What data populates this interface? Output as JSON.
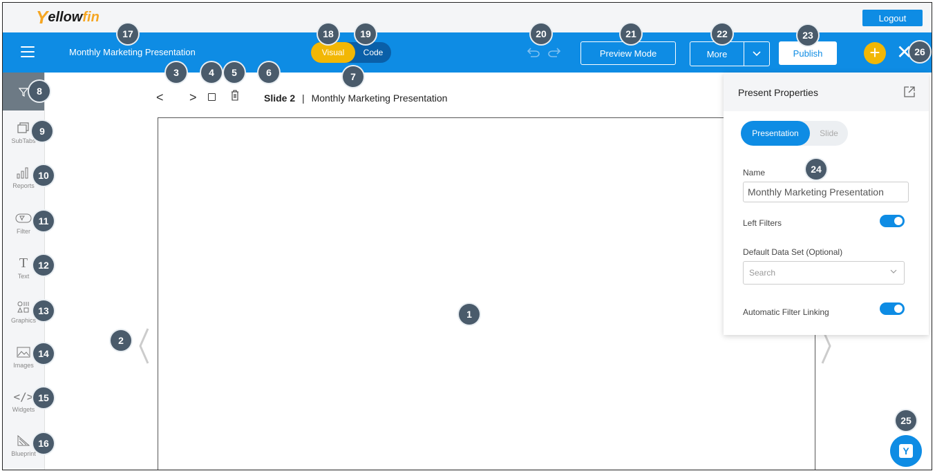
{
  "brand": {
    "logo_prefix": "ellow",
    "logo_suffix": "fin"
  },
  "header": {
    "logout_label": "Logout",
    "doc_title": "Monthly Marketing Presentation",
    "mode_visual": "Visual",
    "mode_code": "Code",
    "preview_label": "Preview Mode",
    "more_label": "More",
    "publish_label": "Publish"
  },
  "sidebar": {
    "items": [
      {
        "label": "SubTabs",
        "icon": "subtabs-icon"
      },
      {
        "label": "Reports",
        "icon": "bar-chart-icon"
      },
      {
        "label": "Filter",
        "icon": "filter-widget-icon"
      },
      {
        "label": "Text",
        "icon": "text-icon"
      },
      {
        "label": "Graphics",
        "icon": "shapes-icon"
      },
      {
        "label": "Images",
        "icon": "image-icon"
      },
      {
        "label": "Widgets",
        "icon": "code-icon"
      },
      {
        "label": "Blueprint",
        "icon": "blueprint-icon"
      }
    ]
  },
  "slide": {
    "number_label": "Slide 2",
    "separator": "|",
    "title": "Monthly Marketing Presentation"
  },
  "properties": {
    "title": "Present Properties",
    "tab_presentation": "Presentation",
    "tab_slide": "Slide",
    "name_label": "Name",
    "name_value": "Monthly Marketing Presentation",
    "left_filters_label": "Left Filters",
    "left_filters_on": true,
    "dataset_label": "Default Data Set (Optional)",
    "dataset_placeholder": "Search",
    "auto_link_label": "Automatic Filter Linking",
    "auto_link_on": true
  },
  "callouts": [
    "1",
    "2",
    "3",
    "4",
    "5",
    "6",
    "7",
    "8",
    "9",
    "10",
    "11",
    "12",
    "13",
    "14",
    "15",
    "16",
    "17",
    "18",
    "19",
    "20",
    "21",
    "22",
    "23",
    "24",
    "25",
    "26"
  ],
  "colors": {
    "primary": "#0e8ce4",
    "accent": "#f2b705",
    "badge": "#4a5b6b"
  }
}
